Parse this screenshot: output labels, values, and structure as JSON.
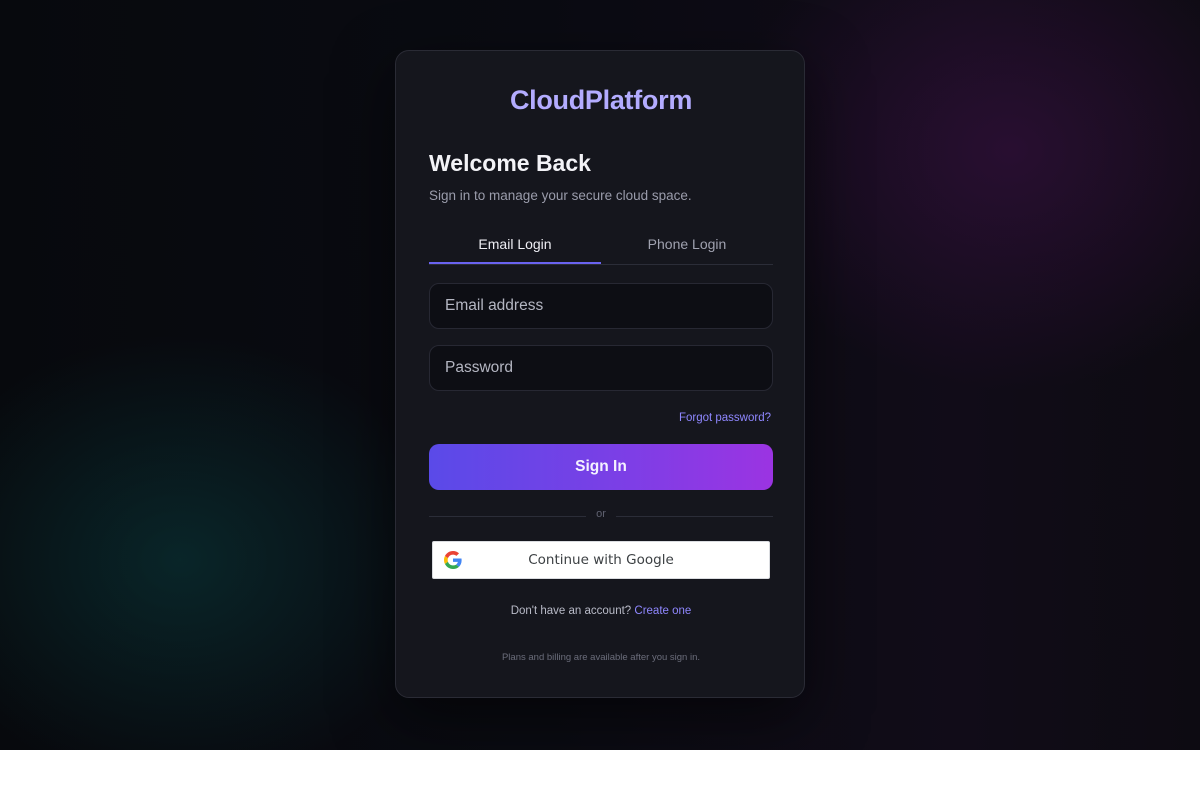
{
  "brand": {
    "name": "CloudPlatform"
  },
  "header": {
    "title": "Welcome Back",
    "subtitle": "Sign in to manage your secure cloud space."
  },
  "tabs": [
    {
      "label": "Email Login",
      "active": true
    },
    {
      "label": "Phone Login",
      "active": false
    }
  ],
  "form": {
    "email": {
      "value": "",
      "placeholder": "Email address"
    },
    "password": {
      "value": "",
      "placeholder": "Password"
    },
    "forgot_label": "Forgot password?",
    "submit_label": "Sign In"
  },
  "divider": {
    "label": "or"
  },
  "google": {
    "label": "Continue with Google",
    "icon": "google-g-icon"
  },
  "signup": {
    "prompt": "Don't have an account?",
    "link_label": "Create one"
  },
  "footer": {
    "note": "Plans and billing are available after you sign in."
  },
  "colors": {
    "accent": "#6a63f0",
    "brand_text": "#b3acff",
    "link": "#8f87ff",
    "button_gradient_start": "#5a4ae8",
    "button_gradient_end": "#9b34e2",
    "card_bg": "#15161d"
  }
}
